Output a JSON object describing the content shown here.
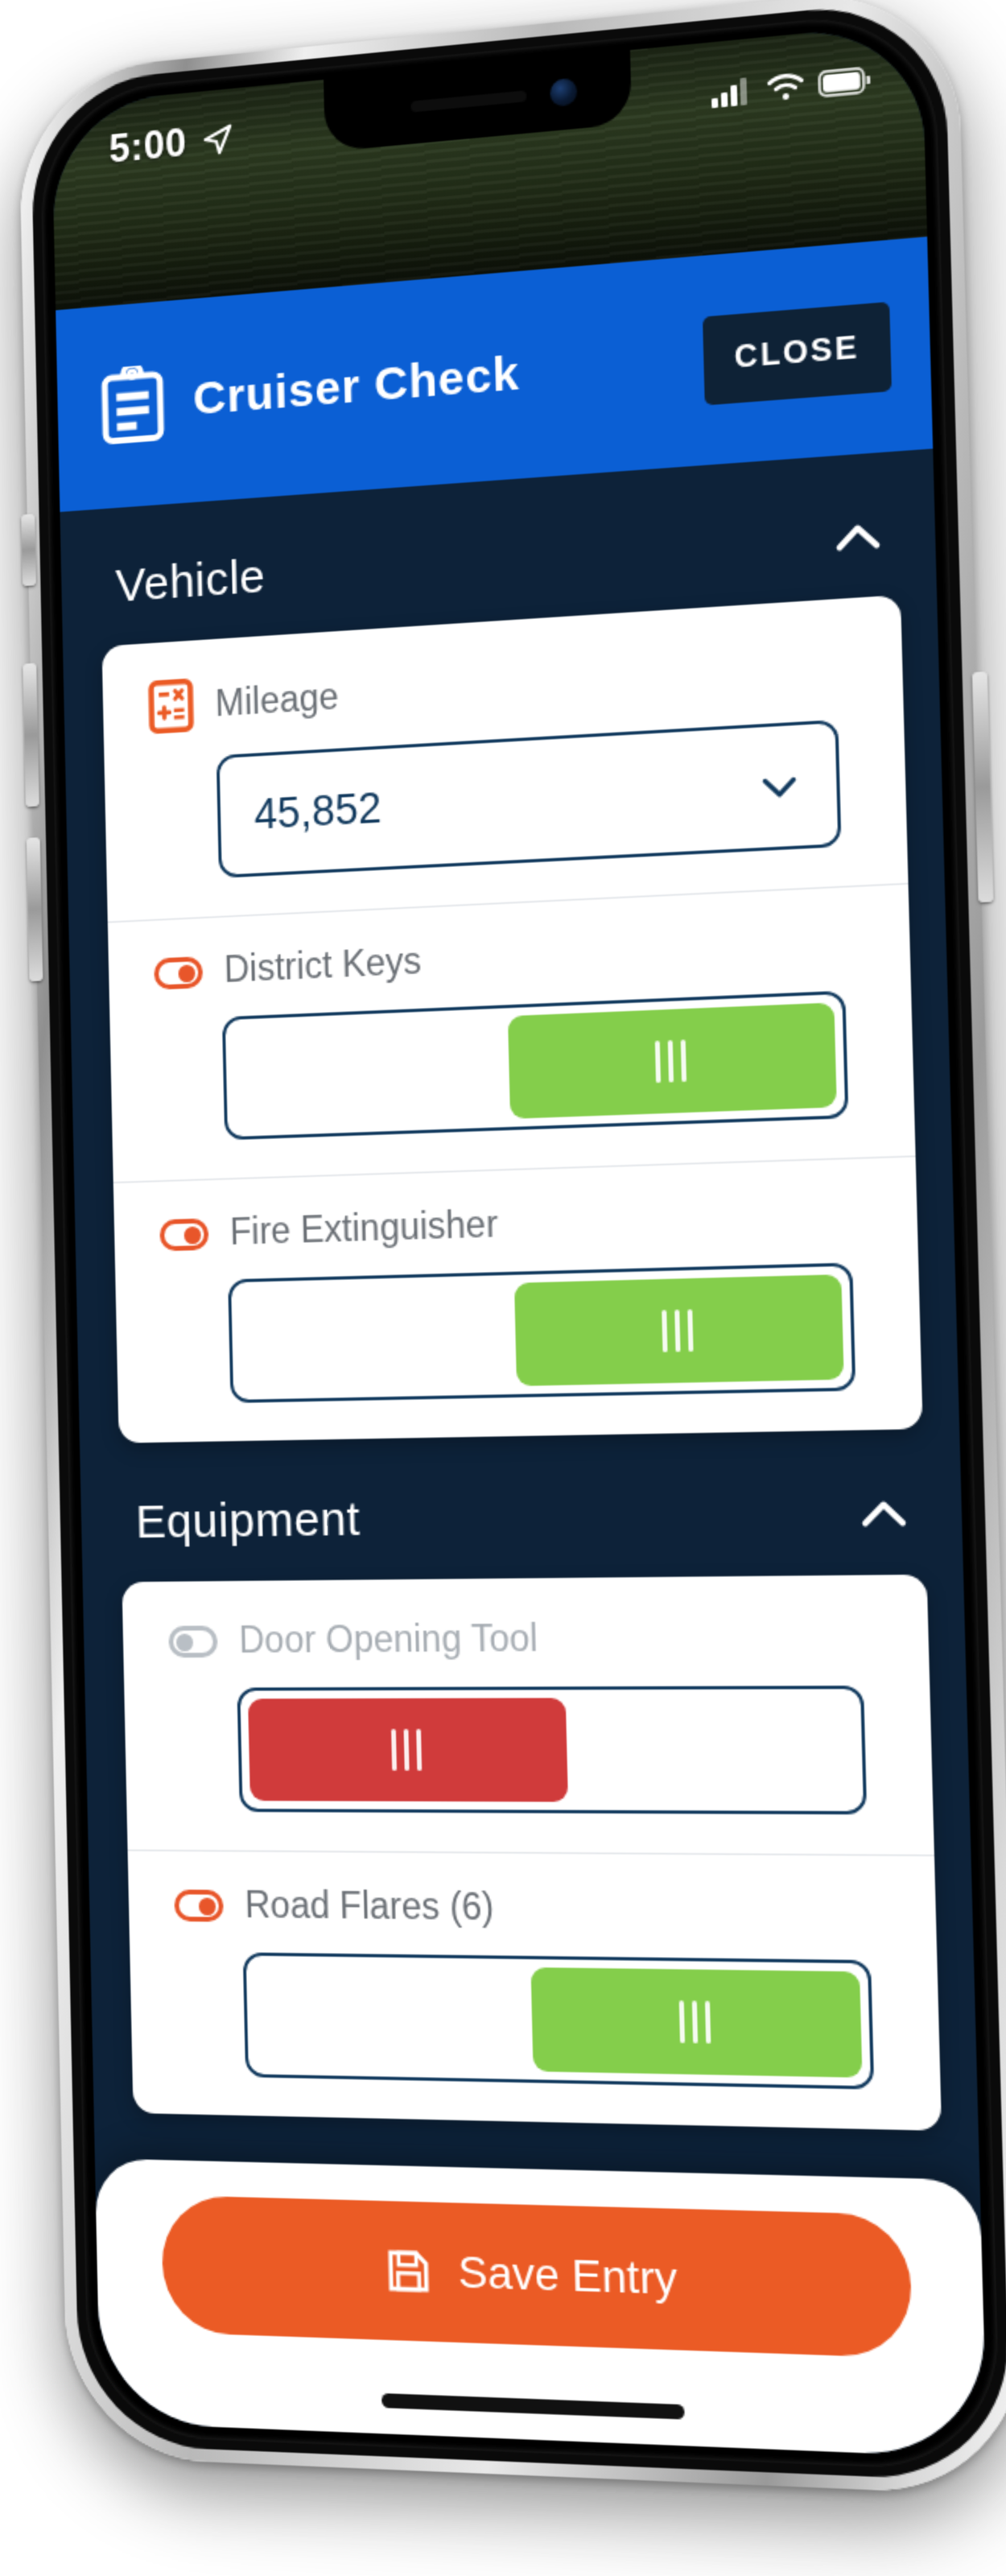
{
  "status_bar": {
    "time": "5:00",
    "location_icon": "location-arrow-icon",
    "signal_icon": "cellular-signal-icon",
    "wifi_icon": "wifi-icon",
    "battery_icon": "battery-full-icon"
  },
  "appbar": {
    "icon": "clipboard-icon",
    "title": "Cruiser Check",
    "close_label": "CLOSE"
  },
  "sections": [
    {
      "title": "Vehicle",
      "collapse_icon": "chevron-up-icon",
      "rows": [
        {
          "icon": "calculator-icon",
          "label": "Mileage",
          "control": "select",
          "value": "45,852",
          "dropdown_icon": "chevron-down-icon"
        },
        {
          "icon": "toggle-on-icon",
          "label": "District Keys",
          "control": "slider",
          "state": "pass",
          "color": "#84CE4B",
          "position": "right"
        },
        {
          "icon": "toggle-on-icon",
          "label": "Fire Extinguisher",
          "control": "slider",
          "state": "pass",
          "color": "#84CE4B",
          "position": "right"
        }
      ]
    },
    {
      "title": "Equipment",
      "collapse_icon": "chevron-up-icon",
      "rows": [
        {
          "icon": "toggle-off-icon",
          "label": "Door Opening Tool",
          "control": "slider",
          "state": "fail",
          "color": "#D03B3B",
          "position": "left"
        },
        {
          "icon": "toggle-on-icon",
          "label": "Road Flares (6)",
          "control": "slider",
          "state": "pass",
          "color": "#84CE4B",
          "position": "right"
        }
      ]
    }
  ],
  "footer": {
    "save_icon": "floppy-disk-icon",
    "save_label": "Save Entry"
  },
  "colors": {
    "header_blue": "#0B5FD4",
    "background_navy": "#0D2239",
    "accent_orange": "#EB5B25",
    "pass_green": "#84CE4B",
    "fail_red": "#D03B3B",
    "field_border": "#123A5E"
  }
}
